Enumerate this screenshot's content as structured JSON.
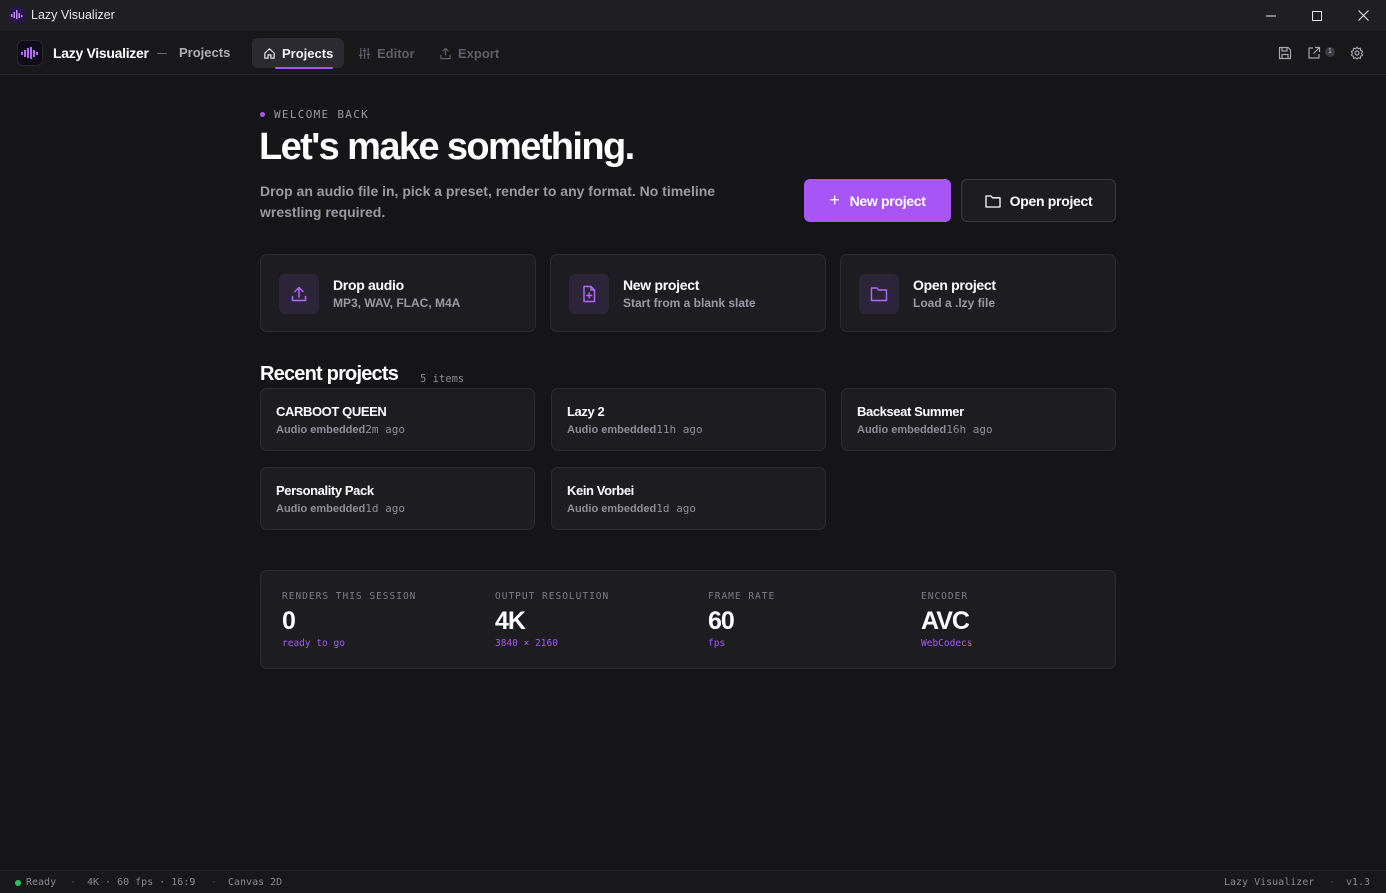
{
  "window": {
    "title": "Lazy Visualizer"
  },
  "header": {
    "brand": "Lazy Visualizer",
    "breadcrumb": "Projects",
    "tabs": [
      {
        "label": "Projects",
        "icon": "home-icon",
        "active": true
      },
      {
        "label": "Editor",
        "icon": "sliders-icon",
        "active": false
      },
      {
        "label": "Export",
        "icon": "upload-icon",
        "active": false
      }
    ],
    "export_badge": "1"
  },
  "hero": {
    "eyebrow": "WELCOME BACK",
    "title": "Let's make something.",
    "subtitle": "Drop an audio file in, pick a preset, render to any format. No timeline wrestling required.",
    "new_project_label": "New project",
    "open_project_label": "Open project"
  },
  "actions": [
    {
      "title": "Drop audio",
      "subtitle": "MP3, WAV, FLAC, M4A",
      "icon": "upload-icon"
    },
    {
      "title": "New project",
      "subtitle": "Start from a blank slate",
      "icon": "file-plus-icon"
    },
    {
      "title": "Open project",
      "subtitle": "Load a .lzy file",
      "icon": "folder-icon"
    }
  ],
  "recent": {
    "title": "Recent projects",
    "count": "5 items",
    "items": [
      {
        "name": "CARBOOT QUEEN",
        "source": "Audio embedded",
        "age": "2m ago"
      },
      {
        "name": "Lazy 2",
        "source": "Audio embedded",
        "age": "11h ago"
      },
      {
        "name": "Backseat Summer",
        "source": "Audio embedded",
        "age": "16h ago"
      },
      {
        "name": "Personality Pack",
        "source": "Audio embedded",
        "age": "1d ago"
      },
      {
        "name": "Kein Vorbei",
        "source": "Audio embedded",
        "age": "1d ago"
      }
    ]
  },
  "stats": [
    {
      "label": "RENDERS THIS SESSION",
      "value": "0",
      "note": "ready to go"
    },
    {
      "label": "OUTPUT RESOLUTION",
      "value": "4K",
      "note": "3840 × 2160"
    },
    {
      "label": "FRAME RATE",
      "value": "60",
      "note": "fps"
    },
    {
      "label": "ENCODER",
      "value": "AVC",
      "note": "WebCodecs"
    }
  ],
  "statusbar": {
    "status": "Ready",
    "format": "4K · 60 fps · 16:9",
    "renderer": "Canvas 2D",
    "app": "Lazy Visualizer",
    "version": "v1.3"
  },
  "colors": {
    "accent": "#a855f7",
    "background": "#151417",
    "card": "#1d1c20",
    "ready": "#22c55e"
  }
}
